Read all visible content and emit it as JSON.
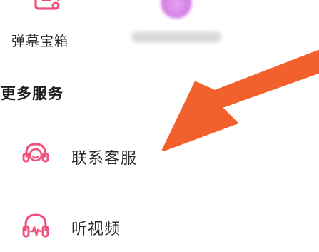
{
  "top_tiles": [
    {
      "label": "弹幕宝箱",
      "icon": "gift-box-icon"
    },
    {
      "label": "",
      "icon": "avatar"
    }
  ],
  "more_services": {
    "title": "更多服务",
    "items": [
      {
        "label": "联系客服",
        "icon": "headset-icon"
      },
      {
        "label": "听视频",
        "icon": "headphone-wave-icon"
      }
    ]
  },
  "colors": {
    "accent": "#f0507a",
    "arrow": "#f2602d",
    "text": "#2a2a2a"
  }
}
